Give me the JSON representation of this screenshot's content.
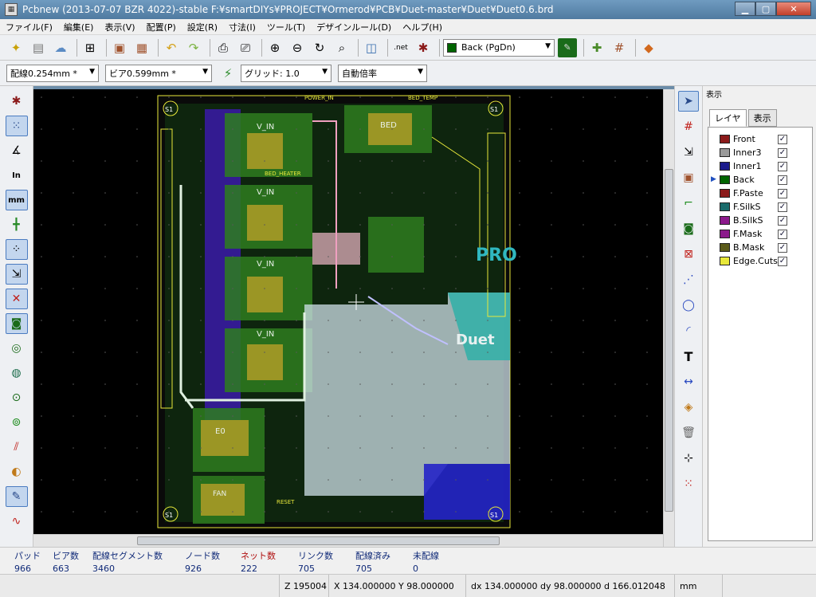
{
  "window": {
    "title": "Pcbnew (2013-07-07 BZR 4022)-stable F:¥smartDIYs¥PROJECT¥Ormerod¥PCB¥Duet-master¥Duet¥Duet0.6.brd",
    "app_icon": "pcbnew-app-icon"
  },
  "menu": [
    "ファイル(F)",
    "編集(E)",
    "表示(V)",
    "配置(P)",
    "設定(R)",
    "寸法(I)",
    "ツール(T)",
    "デザインルール(D)",
    "ヘルプ(H)"
  ],
  "toolbar": {
    "active_layer": "Back (PgDn)",
    "active_layer_color": "#006400",
    "net_label": ".net"
  },
  "aux_toolbar": {
    "track_width": "配線0.254mm *",
    "via_size": "ビア0.599mm *",
    "grid": "グリッド: 1.0",
    "zoom": "自動倍率"
  },
  "left_tools": {
    "in_label": "In",
    "mm_label": "mm"
  },
  "right_tools": {
    "text_label": "T"
  },
  "layers_panel": {
    "title": "表示",
    "tabs": [
      "レイヤ",
      "表示"
    ],
    "layers": [
      {
        "name": "Front",
        "color": "#8b1a1a",
        "checked": true,
        "active": false
      },
      {
        "name": "Inner3",
        "color": "#9a9a9a",
        "checked": true,
        "active": false
      },
      {
        "name": "Inner1",
        "color": "#1a1a8b",
        "checked": true,
        "active": false
      },
      {
        "name": "Back",
        "color": "#006400",
        "checked": true,
        "active": true
      },
      {
        "name": "F.Paste",
        "color": "#8b1a1a",
        "checked": true,
        "active": false
      },
      {
        "name": "F.SilkS",
        "color": "#1a6b6b",
        "checked": true,
        "active": false
      },
      {
        "name": "B.SilkS",
        "color": "#8b1a8b",
        "checked": true,
        "active": false
      },
      {
        "name": "F.Mask",
        "color": "#8b1a8b",
        "checked": true,
        "active": false
      },
      {
        "name": "B.Mask",
        "color": "#5a5a1a",
        "checked": true,
        "active": false
      },
      {
        "name": "Edge.Cuts",
        "color": "#e8e83a",
        "checked": true,
        "active": false
      }
    ]
  },
  "board_labels": {
    "s1": "S1",
    "vin": "V_IN",
    "bed": "BED",
    "e0": "E0",
    "fan": "FAN",
    "duet": "Duet",
    "pro": "PRO",
    "reset": "RESET",
    "power_in": "POWER_IN",
    "bed_heater": "BED_HEATER",
    "bed_temp": "BED_TEMP"
  },
  "info": {
    "columns": [
      {
        "label": "パッド",
        "value": "966",
        "color": "#102a78"
      },
      {
        "label": "ビア数",
        "value": "663",
        "color": "#102a78"
      },
      {
        "label": "配線セグメント数",
        "value": "3460",
        "color": "#102a78"
      },
      {
        "label": "ノード数",
        "value": "926",
        "color": "#102a78"
      },
      {
        "label": "ネット数",
        "value": "222",
        "color": "#b01010"
      },
      {
        "label": "リンク数",
        "value": "705",
        "color": "#102a78"
      },
      {
        "label": "配線済み",
        "value": "705",
        "color": "#102a78"
      },
      {
        "label": "未配線",
        "value": "0",
        "color": "#102a78"
      }
    ]
  },
  "status": {
    "z": "Z 195004",
    "xy": "X 134.000000  Y 98.000000",
    "dxy": "dx 134.000000  dy 98.000000  d 166.012048",
    "units": "mm"
  }
}
